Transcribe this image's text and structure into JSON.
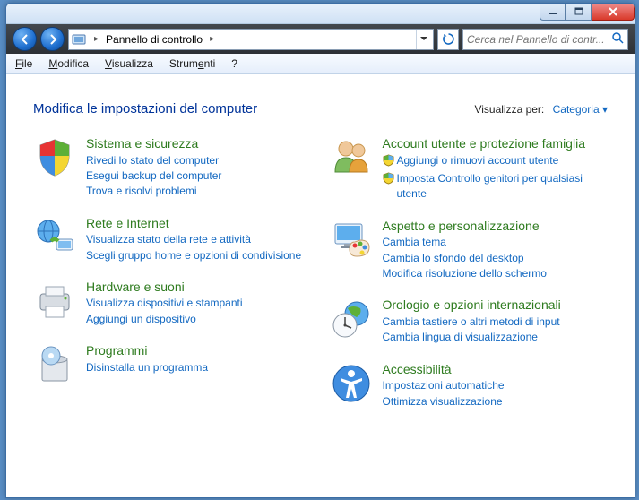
{
  "titlebar": {},
  "navbar": {
    "breadcrumb": {
      "label": "Pannello di controllo"
    }
  },
  "search": {
    "placeholder": "Cerca nel Pannello di contr..."
  },
  "menu": {
    "file": "File",
    "modifica": "Modifica",
    "visualizza": "Visualizza",
    "strumenti": "Strumenti",
    "help": "?"
  },
  "header": {
    "title": "Modifica le impostazioni del computer",
    "view_by_label": "Visualizza per:",
    "view_by_value": "Categoria ▾"
  },
  "categories": {
    "system": {
      "title": "Sistema e sicurezza",
      "l1": "Rivedi lo stato del computer",
      "l2": "Esegui backup del computer",
      "l3": "Trova e risolvi problemi"
    },
    "network": {
      "title": "Rete e Internet",
      "l1": "Visualizza stato della rete e attività",
      "l2": "Scegli gruppo home e opzioni di condivisione"
    },
    "hardware": {
      "title": "Hardware e suoni",
      "l1": "Visualizza dispositivi e stampanti",
      "l2": "Aggiungi un dispositivo"
    },
    "programs": {
      "title": "Programmi",
      "l1": "Disinstalla un programma"
    },
    "users": {
      "title": "Account utente e protezione famiglia",
      "l1": "Aggiungi o rimuovi account utente",
      "l2": "Imposta Controllo genitori per qualsiasi utente"
    },
    "appearance": {
      "title": "Aspetto e personalizzazione",
      "l1": "Cambia tema",
      "l2": "Cambia lo sfondo del desktop",
      "l3": "Modifica risoluzione dello schermo"
    },
    "clock": {
      "title": "Orologio e opzioni internazionali",
      "l1": "Cambia tastiere o altri metodi di input",
      "l2": "Cambia lingua di visualizzazione"
    },
    "access": {
      "title": "Accessibilità",
      "l1": "Impostazioni automatiche",
      "l2": "Ottimizza visualizzazione"
    }
  }
}
